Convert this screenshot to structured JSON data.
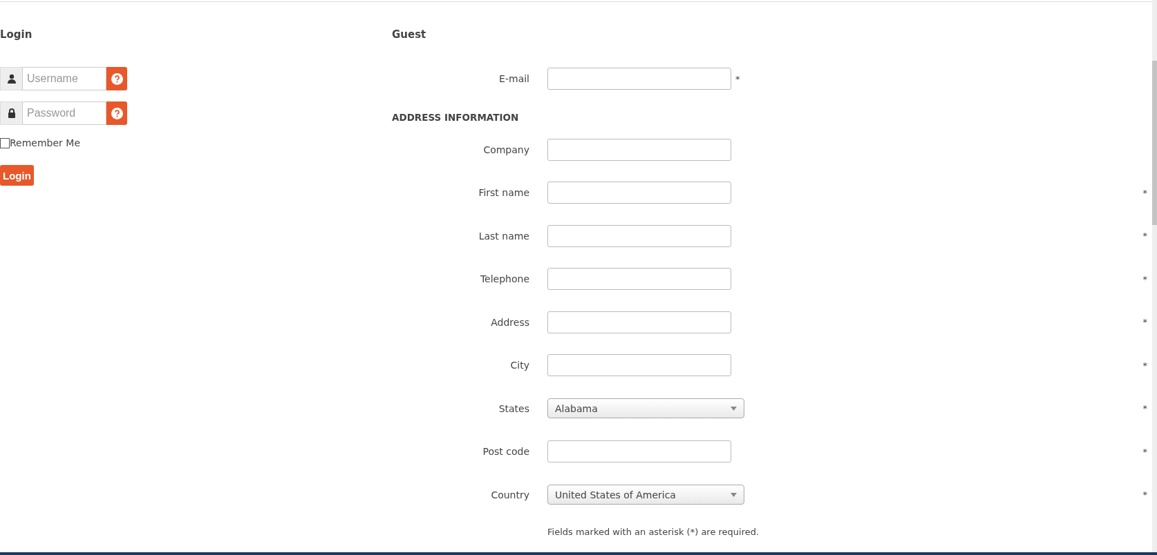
{
  "login": {
    "title": "Login",
    "fields": [
      {
        "kind": "user",
        "placeholder": "Username"
      },
      {
        "kind": "lock",
        "placeholder": "Password"
      }
    ],
    "remember": {
      "label": "Remember Me",
      "checked": false
    },
    "button": "Login"
  },
  "guest": {
    "title": "Guest",
    "email": {
      "label": "E-mail",
      "marker": "*"
    },
    "section": "ADDRESS INFORMATION",
    "fields": [
      {
        "kind": "text",
        "label": "Company"
      },
      {
        "kind": "text",
        "label": "First name",
        "marker": "*"
      },
      {
        "kind": "text",
        "label": "Last name",
        "marker": "*"
      },
      {
        "kind": "text",
        "label": "Telephone",
        "marker": "*"
      },
      {
        "kind": "text",
        "label": "Address",
        "marker": "*"
      },
      {
        "kind": "text",
        "label": "City",
        "marker": "*"
      },
      {
        "kind": "select",
        "label": "States",
        "value": "Alabama",
        "marker": "*"
      },
      {
        "kind": "text",
        "label": "Post code",
        "marker": "*"
      },
      {
        "kind": "select",
        "label": "Country",
        "value": "United States of America",
        "marker": "*"
      }
    ],
    "note": "Fields marked with an asterisk (*) are required."
  }
}
